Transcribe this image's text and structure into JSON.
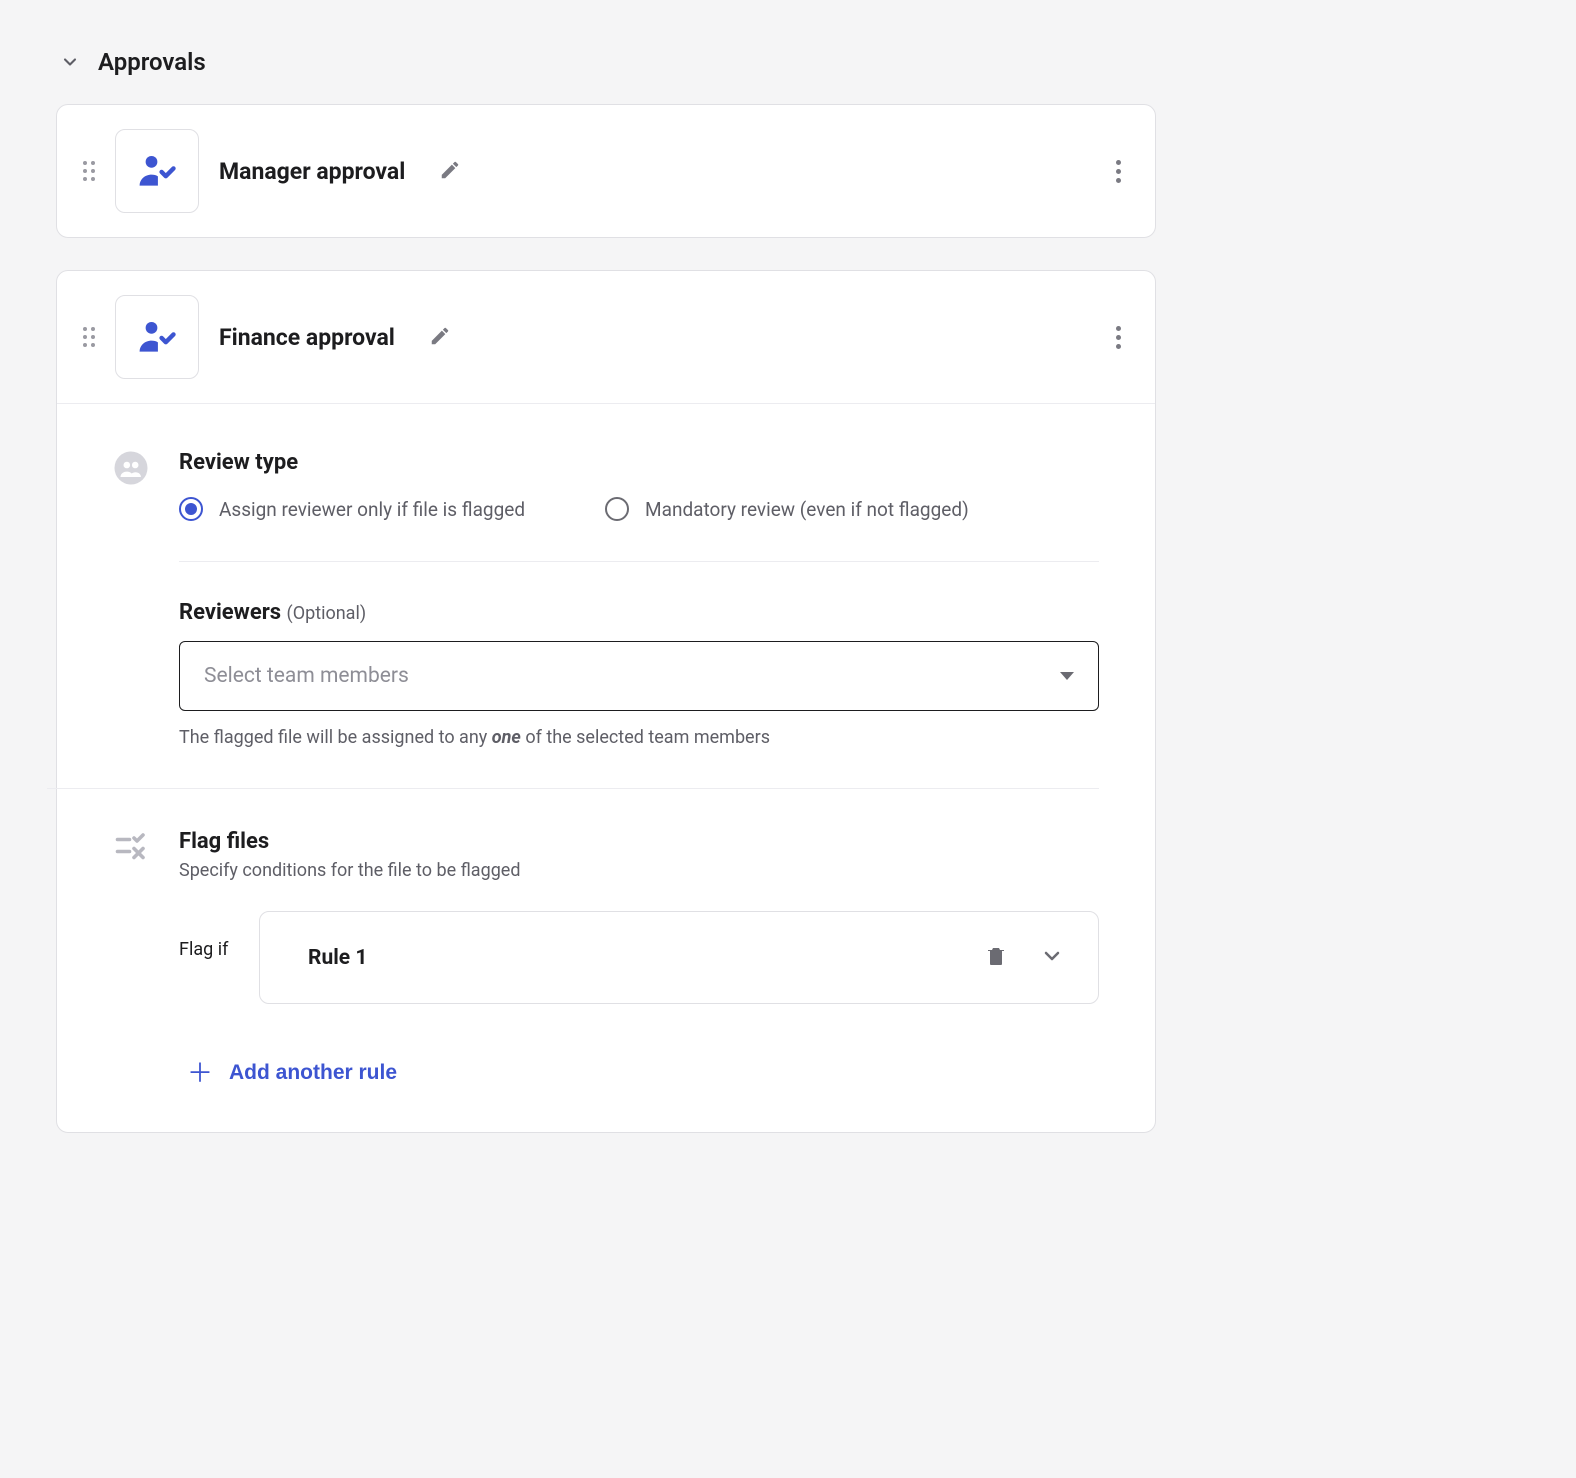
{
  "section": {
    "title": "Approvals"
  },
  "cards": [
    {
      "title": "Manager approval"
    },
    {
      "title": "Finance approval"
    }
  ],
  "reviewType": {
    "heading": "Review type",
    "options": [
      {
        "label": "Assign reviewer only if file is flagged",
        "checked": true
      },
      {
        "label": "Mandatory review (even if not flagged)",
        "checked": false
      }
    ]
  },
  "reviewers": {
    "label": "Reviewers",
    "optional": "(Optional)",
    "placeholder": "Select team members",
    "helper_pre": "The flagged file will be assigned to any ",
    "helper_em": "one",
    "helper_post": " of the selected team members"
  },
  "flag": {
    "heading": "Flag files",
    "subdesc": "Specify conditions for the file to be flagged",
    "flag_if": "Flag if",
    "rules": [
      {
        "title": "Rule 1"
      }
    ],
    "add_label": "Add another rule"
  }
}
